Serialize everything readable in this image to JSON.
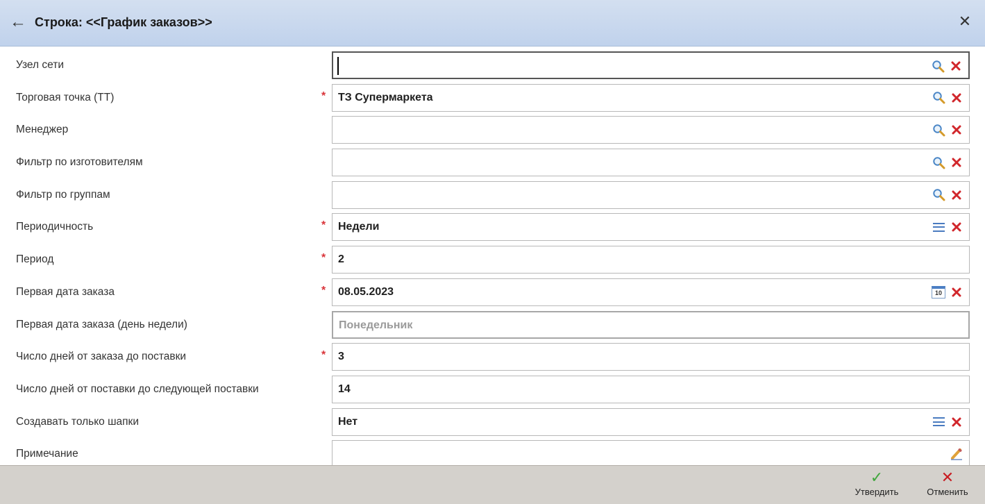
{
  "header": {
    "title": "Строка: <<График заказов>>",
    "back_glyph": "←",
    "close_glyph": "✕"
  },
  "fields": [
    {
      "label": "Узел сети",
      "value": "",
      "required": false,
      "icons": [
        "search-icon",
        "clear-icon"
      ],
      "focused": true
    },
    {
      "label": "Торговая точка (ТТ)",
      "value": "ТЗ Супермаркета",
      "required": true,
      "icons": [
        "search-icon",
        "clear-icon"
      ]
    },
    {
      "label": "Менеджер",
      "value": "",
      "required": false,
      "icons": [
        "search-icon",
        "clear-icon"
      ]
    },
    {
      "label": "Фильтр по изготовителям",
      "value": "",
      "required": false,
      "icons": [
        "search-icon",
        "clear-icon"
      ]
    },
    {
      "label": "Фильтр по группам",
      "value": "",
      "required": false,
      "icons": [
        "search-icon",
        "clear-icon"
      ]
    },
    {
      "label": "Периодичность",
      "value": "Недели",
      "required": true,
      "icons": [
        "list-icon",
        "clear-icon"
      ]
    },
    {
      "label": "Период",
      "value": "2",
      "required": true,
      "icons": []
    },
    {
      "label": "Первая дата заказа",
      "value": "08.05.2023",
      "required": true,
      "icons": [
        "calendar-icon",
        "clear-icon"
      ]
    },
    {
      "label": "Первая дата заказа (день недели)",
      "value": "Понедельник",
      "required": false,
      "icons": [],
      "disabled": true
    },
    {
      "label": "Число дней от заказа до поставки",
      "value": "3",
      "required": true,
      "icons": []
    },
    {
      "label": "Число дней от поставки до следующей поставки",
      "value": "14",
      "required": false,
      "icons": []
    },
    {
      "label": "Создавать только шапки",
      "value": "Нет",
      "required": false,
      "icons": [
        "list-icon",
        "clear-icon"
      ]
    },
    {
      "label": "Примечание",
      "value": "",
      "required": false,
      "icons": [
        "edit-icon"
      ]
    }
  ],
  "required_marker": "*",
  "calendar_icon_text": "10",
  "footer": {
    "confirm_label": "Утвердить",
    "cancel_label": "Отменить",
    "confirm_glyph": "✓",
    "cancel_glyph": "✕"
  },
  "colors": {
    "titlebar": "#c6d6ee",
    "required": "#d9343a",
    "clear": "#d1262b",
    "confirm": "#3fa63b",
    "cancel": "#c81c22"
  }
}
